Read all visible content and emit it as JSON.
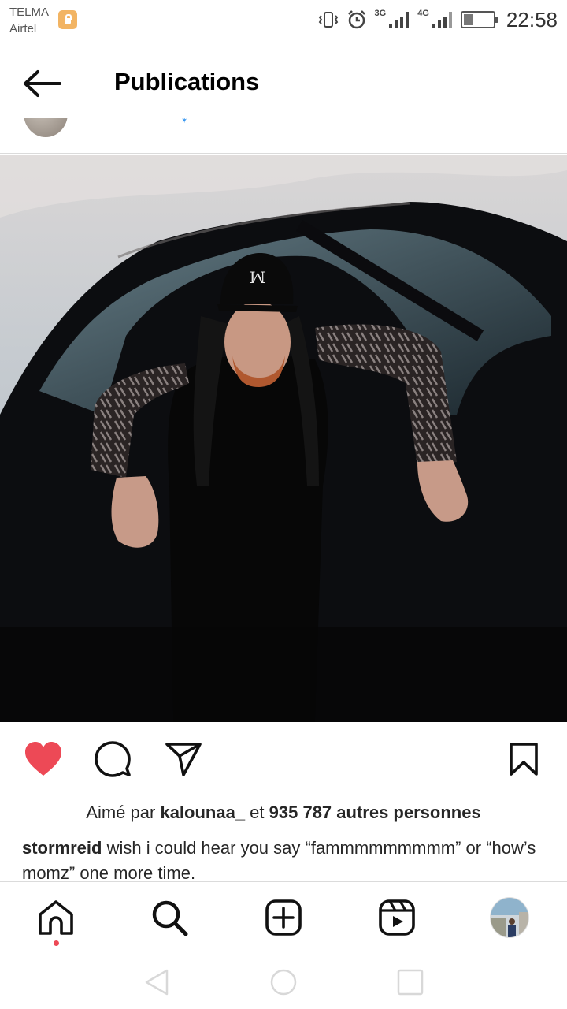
{
  "status_bar": {
    "carrier_line1": "TELMA",
    "carrier_line2": "Airtel",
    "network_a": "3G",
    "network_b": "4G",
    "battery_level": 0.3,
    "time": "22:58"
  },
  "header": {
    "title": "Publications"
  },
  "post": {
    "liked": true,
    "likes": {
      "prefix": "Aimé par ",
      "user": "kalounaa_",
      "middle": " et ",
      "others": "935 787 autres personnes"
    },
    "caption": {
      "user": "stormreid",
      "text": " wish i could hear you say “fammmmmmmmm” or “how’s momz” one more time."
    }
  },
  "colors": {
    "like_red": "#ed4956",
    "verified_blue": "#3897f0",
    "text": "#262626"
  },
  "icons": {
    "back": "arrow-left-icon",
    "like": "heart-icon",
    "comment": "comment-icon",
    "share": "send-icon",
    "save": "bookmark-icon",
    "home": "home-icon",
    "search": "search-icon",
    "create": "plus-square-icon",
    "reels": "reels-icon"
  }
}
